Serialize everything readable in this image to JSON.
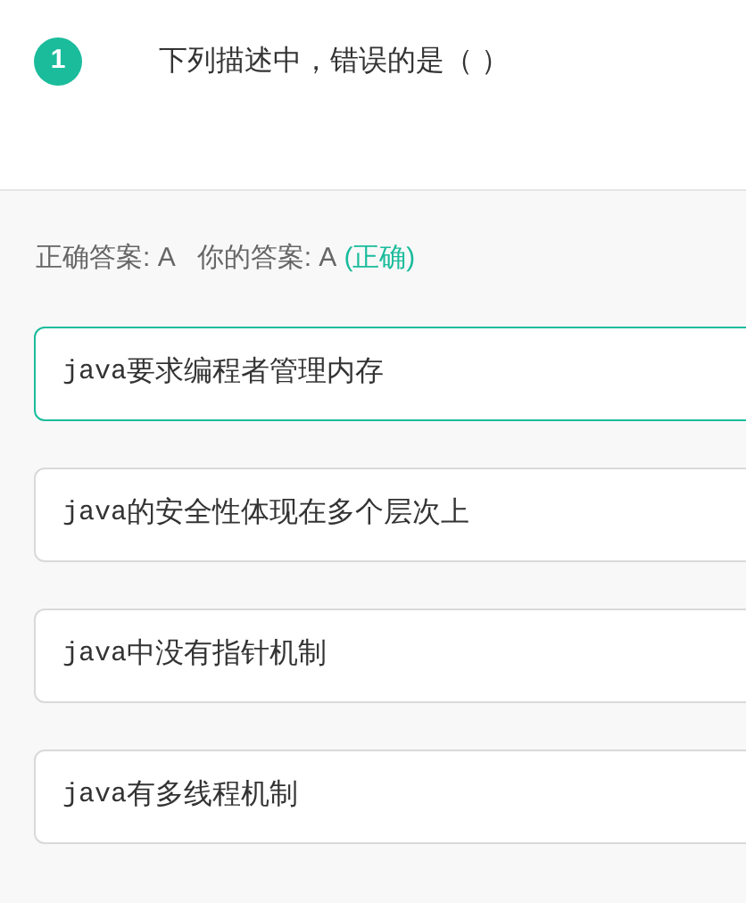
{
  "question": {
    "number": "1",
    "text": "下列描述中，错误的是（ ）"
  },
  "result": {
    "correct_label": "正确答案: A",
    "your_label": "你的答案: A",
    "verdict": "(正确)"
  },
  "options": [
    {
      "code": "java",
      "text": "要求编程者管理内存",
      "selected": true
    },
    {
      "code": "java",
      "text": "的安全性体现在多个层次上",
      "selected": false
    },
    {
      "code": "java",
      "text": "中没有指针机制",
      "selected": false
    },
    {
      "code": "java",
      "text": "有多线程机制",
      "selected": false
    }
  ]
}
